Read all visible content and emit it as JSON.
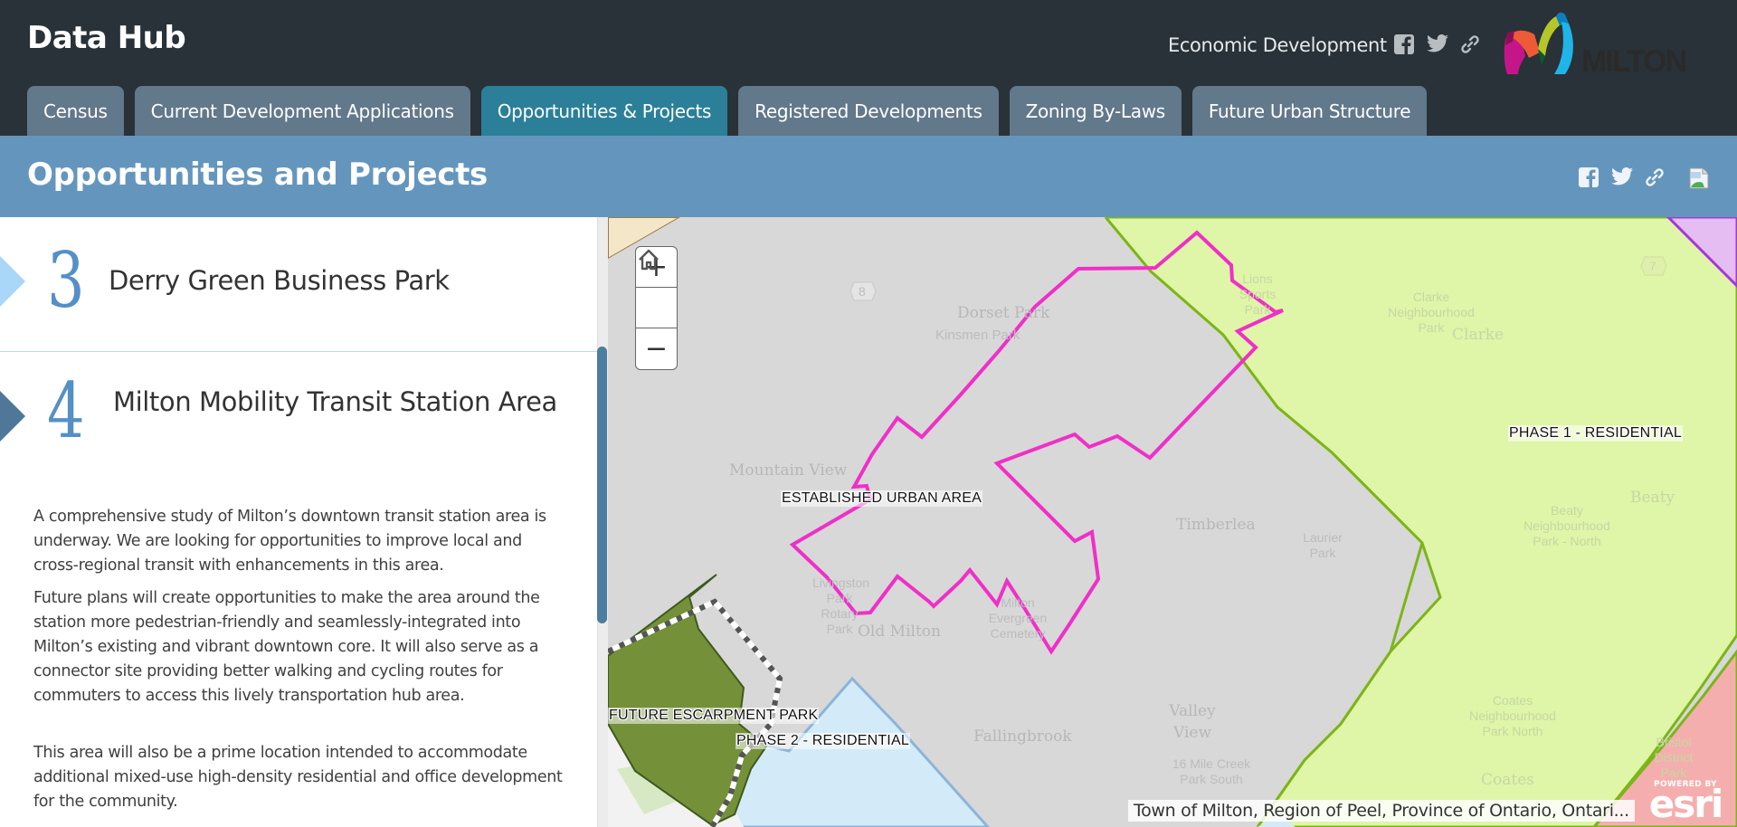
{
  "header": {
    "app_title": "Data Hub",
    "org_link": "Economic Development",
    "logo_text": "MILTON",
    "social": [
      "facebook",
      "twitter",
      "link"
    ]
  },
  "tabs": [
    {
      "label": "Census",
      "active": false
    },
    {
      "label": "Current Development Applications",
      "active": false
    },
    {
      "label": "Opportunities & Projects",
      "active": true
    },
    {
      "label": "Registered Developments",
      "active": false
    },
    {
      "label": "Zoning By-Laws",
      "active": false
    },
    {
      "label": "Future Urban Structure",
      "active": false
    }
  ],
  "section": {
    "title": "Opportunities and Projects",
    "share_icons": [
      "facebook",
      "twitter",
      "link",
      "broken-image"
    ]
  },
  "story": {
    "items": [
      {
        "number": "3",
        "title": "Derry Green Business Park"
      },
      {
        "number": "4",
        "title": "Milton Mobility Transit Station Area",
        "active": true
      }
    ],
    "body": [
      "A comprehensive study of Milton’s downtown transit station area is underway. We are looking for opportunities to improve local and cross-regional transit with enhancements in this area.",
      "Future plans will create opportunities to make the area around the station more pedestrian-friendly and seamlessly-integrated into Milton’s existing and vibrant downtown core. It will also serve as a connector site providing better walking and cycling routes for commuters to access this lively transportation hub area.",
      "This area will also be a prime location intended to accommodate additional mixed-use high-density residential and office development for the community."
    ]
  },
  "map": {
    "controls": {
      "zoom_in": "+",
      "home": "home",
      "zoom_out": "−"
    },
    "overlay_labels": {
      "established": "ESTABLISHED URBAN AREA",
      "phase1": "PHASE 1 - RESIDENTIAL",
      "escarpment": "FUTURE ESCARPMENT PARK",
      "phase2": "PHASE 2 - RESIDENTIAL"
    },
    "base_labels": {
      "dorset_park": "Dorset Park",
      "kinsmen_park": "Kinsmen Park",
      "mountain_view": "Mountain View",
      "old_milton": "Old Milton",
      "timberlea": "Timberlea",
      "fallingbrook": "Fallingbrook",
      "valley_view": "Valley View",
      "clarke": "Clarke",
      "clarke_park": "Clarke Neighbourhood Park",
      "beaty": "Beaty",
      "beaty_park": "Beaty Neighbourhood Park - North",
      "coates": "Coates",
      "coates_park": "Coates Neighbourhood Park North",
      "livingston": "Livingston Park",
      "rotary": "Rotary Park",
      "evergreen": "Milton Evergreen Cemetery",
      "laurier_park": "Laurier Park",
      "lions": "Lions Sports Park",
      "creek_park": "16 Mile Creek Park South",
      "bristol": "Bristol District Park",
      "route_8": "8",
      "route_7": "7"
    },
    "attribution": "Town of Milton, Region of Peel, Province of Ontario, Ontari...",
    "esri_powered": "POWERED BY",
    "esri_name": "esri",
    "colors": {
      "established": "#d8d8d8",
      "phase1": "#dff5a8",
      "phase1_stroke": "#7cb518",
      "escarpment": "#74913a",
      "transit_outline": "#f02fc8",
      "phase2": "#d3ebf8",
      "purple_zone": "#e5bdf2",
      "pink_zone": "#f5aeae",
      "beige_zone": "#f4e7c8"
    }
  }
}
